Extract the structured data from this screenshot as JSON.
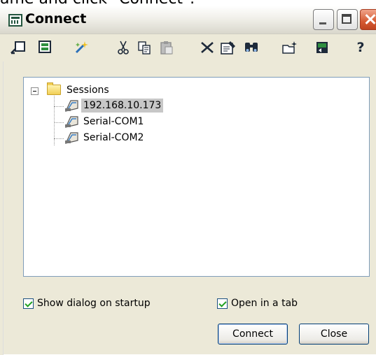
{
  "instruction_fragment": "ame and click \"Connect\".",
  "window": {
    "title": "Connect"
  },
  "toolbar": {
    "icons": [
      "quick-connect-icon",
      "connect-in-tab-icon",
      "new-session-icon",
      "cut-icon",
      "copy-icon",
      "paste-icon",
      "delete-icon",
      "properties-icon",
      "find-icon",
      "new-folder-icon",
      "desktop-shortcut-icon",
      "help-icon"
    ]
  },
  "tree": {
    "root_label": "Sessions",
    "sessions": [
      {
        "label": "192.168.10.173",
        "selected": true
      },
      {
        "label": "Serial-COM1",
        "selected": false
      },
      {
        "label": "Serial-COM2",
        "selected": false
      }
    ]
  },
  "options": {
    "show_dialog_label": "Show dialog on startup",
    "show_dialog_checked": true,
    "open_in_tab_label": "Open in a tab",
    "open_in_tab_checked": true
  },
  "buttons": {
    "connect_label": "Connect",
    "close_label": "Close"
  }
}
